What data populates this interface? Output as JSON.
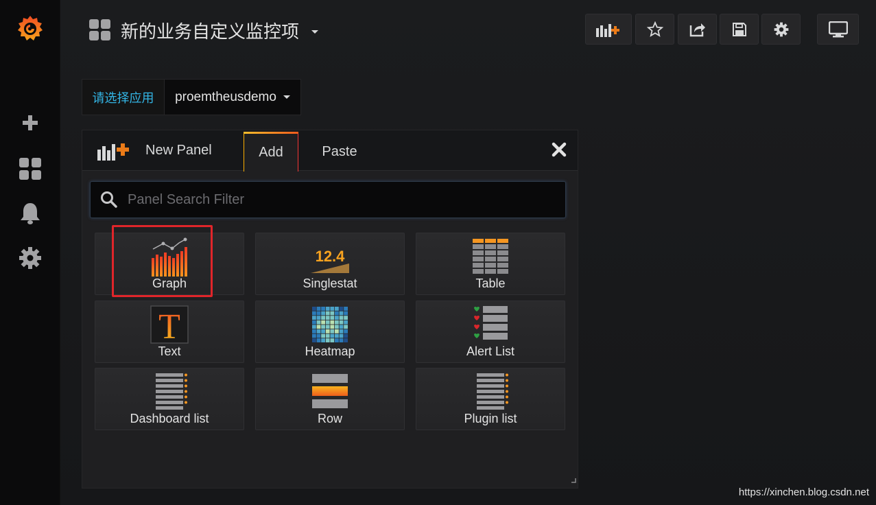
{
  "colors": {
    "accent_orange": "#eb7b18",
    "link_blue": "#33b5e5",
    "highlight_red": "#e0252a"
  },
  "sidebar": {
    "items": [
      {
        "icon": "grafana-logo-icon"
      },
      {
        "icon": "plus-icon"
      },
      {
        "icon": "dashboards-grid-icon"
      },
      {
        "icon": "bell-icon"
      },
      {
        "icon": "gear-icon"
      }
    ]
  },
  "header": {
    "title": "新的业务自定义监控项",
    "buttons": [
      {
        "icon": "add-panel-icon"
      },
      {
        "icon": "star-icon"
      },
      {
        "icon": "share-icon"
      },
      {
        "icon": "save-icon"
      },
      {
        "icon": "settings-icon"
      },
      {
        "icon": "tv-mode-icon"
      }
    ]
  },
  "variable": {
    "label": "请选择应用",
    "value": "proemtheusdemo"
  },
  "panel": {
    "title": "New Panel",
    "tabs": [
      "Add",
      "Paste"
    ],
    "active_tab": "Add",
    "search": {
      "placeholder": "Panel Search Filter",
      "value": ""
    },
    "items": [
      {
        "label": "Graph",
        "icon": "graph-icon"
      },
      {
        "label": "Singlestat",
        "icon": "singlestat-icon",
        "icon_text": "12.4"
      },
      {
        "label": "Table",
        "icon": "table-icon"
      },
      {
        "label": "Text",
        "icon": "text-icon",
        "icon_text": "T"
      },
      {
        "label": "Heatmap",
        "icon": "heatmap-icon"
      },
      {
        "label": "Alert List",
        "icon": "alert-list-icon"
      },
      {
        "label": "Dashboard list",
        "icon": "dashboard-list-icon"
      },
      {
        "label": "Row",
        "icon": "row-icon"
      },
      {
        "label": "Plugin list",
        "icon": "plugin-list-icon"
      }
    ]
  },
  "watermark": "https://xinchen.blog.csdn.net"
}
